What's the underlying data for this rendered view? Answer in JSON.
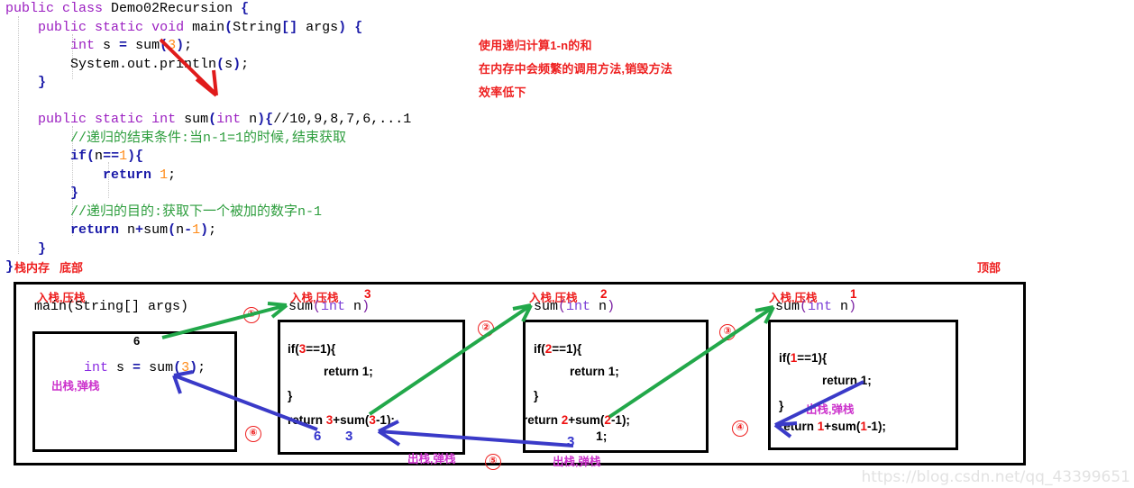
{
  "code": {
    "lines": [
      [
        {
          "t": "public",
          "c": "kw"
        },
        {
          "t": " ",
          "c": ""
        },
        {
          "t": "class",
          "c": "kw"
        },
        {
          "t": " Demo02Recursion ",
          "c": ""
        },
        {
          "t": "{",
          "c": "blu"
        }
      ],
      [
        {
          "t": "    ",
          "c": ""
        },
        {
          "t": "public",
          "c": "kw"
        },
        {
          "t": " ",
          "c": ""
        },
        {
          "t": "static",
          "c": "kw"
        },
        {
          "t": " ",
          "c": ""
        },
        {
          "t": "void",
          "c": "kw"
        },
        {
          "t": " main",
          "c": ""
        },
        {
          "t": "(",
          "c": "blu"
        },
        {
          "t": "String",
          "c": ""
        },
        {
          "t": "[]",
          "c": "blu"
        },
        {
          "t": " args",
          "c": ""
        },
        {
          "t": ")",
          "c": "blu"
        },
        {
          "t": " ",
          "c": ""
        },
        {
          "t": "{",
          "c": "blu"
        }
      ],
      [
        {
          "t": "        ",
          "c": ""
        },
        {
          "t": "int",
          "c": "kw"
        },
        {
          "t": " s ",
          "c": ""
        },
        {
          "t": "=",
          "c": "blu"
        },
        {
          "t": " sum",
          "c": ""
        },
        {
          "t": "(",
          "c": "blu"
        },
        {
          "t": "3",
          "c": "num"
        },
        {
          "t": ")",
          "c": "blu"
        },
        {
          "t": ";",
          "c": ""
        }
      ],
      [
        {
          "t": "        System.out.println",
          "c": ""
        },
        {
          "t": "(",
          "c": "blu"
        },
        {
          "t": "s",
          "c": ""
        },
        {
          "t": ")",
          "c": "blu"
        },
        {
          "t": ";",
          "c": ""
        }
      ],
      [
        {
          "t": "    ",
          "c": ""
        },
        {
          "t": "}",
          "c": "blu"
        }
      ],
      [
        {
          "t": "",
          "c": ""
        }
      ],
      [
        {
          "t": "    ",
          "c": ""
        },
        {
          "t": "public",
          "c": "kw"
        },
        {
          "t": " ",
          "c": ""
        },
        {
          "t": "static",
          "c": "kw"
        },
        {
          "t": " ",
          "c": ""
        },
        {
          "t": "int",
          "c": "kw"
        },
        {
          "t": " sum",
          "c": ""
        },
        {
          "t": "(",
          "c": "blu"
        },
        {
          "t": "int",
          "c": "kw"
        },
        {
          "t": " n",
          "c": ""
        },
        {
          "t": ")",
          "c": "blu"
        },
        {
          "t": "{",
          "c": "blu"
        },
        {
          "t": "//10,9,8,7,6,...1",
          "c": ""
        }
      ],
      [
        {
          "t": "        ",
          "c": ""
        },
        {
          "t": "//递归的结束条件:当n-1=1的时候,结束获取",
          "c": "cmt"
        }
      ],
      [
        {
          "t": "        ",
          "c": ""
        },
        {
          "t": "if",
          "c": "blu"
        },
        {
          "t": "(",
          "c": "blu"
        },
        {
          "t": "n",
          "c": ""
        },
        {
          "t": "==",
          "c": "blu"
        },
        {
          "t": "1",
          "c": "num"
        },
        {
          "t": ")",
          "c": "blu"
        },
        {
          "t": "{",
          "c": "blu"
        }
      ],
      [
        {
          "t": "            ",
          "c": ""
        },
        {
          "t": "return",
          "c": "blu"
        },
        {
          "t": " ",
          "c": ""
        },
        {
          "t": "1",
          "c": "num"
        },
        {
          "t": ";",
          "c": ""
        }
      ],
      [
        {
          "t": "        ",
          "c": ""
        },
        {
          "t": "}",
          "c": "blu"
        }
      ],
      [
        {
          "t": "        ",
          "c": ""
        },
        {
          "t": "//递归的目的:获取下一个被加的数字n-1",
          "c": "cmt"
        }
      ],
      [
        {
          "t": "        ",
          "c": ""
        },
        {
          "t": "return",
          "c": "blu"
        },
        {
          "t": " n",
          "c": ""
        },
        {
          "t": "+",
          "c": "blu"
        },
        {
          "t": "sum",
          "c": ""
        },
        {
          "t": "(",
          "c": "blu"
        },
        {
          "t": "n",
          "c": ""
        },
        {
          "t": "-",
          "c": "blu"
        },
        {
          "t": "1",
          "c": "num"
        },
        {
          "t": ")",
          "c": "blu"
        },
        {
          "t": ";",
          "c": ""
        }
      ],
      [
        {
          "t": "    ",
          "c": ""
        },
        {
          "t": "}",
          "c": "blu"
        }
      ],
      [
        {
          "t": "",
          "c": "blu"
        },
        {
          "t": "}",
          "c": "blu"
        }
      ]
    ]
  },
  "notes": {
    "line1": "使用递归计算1-n的和",
    "line2": "在内存中会频繁的调用方法,销毁方法",
    "line3": "效率低下"
  },
  "stack": {
    "memory_label": "栈内存",
    "bottom_label": "底部",
    "top_label": "顶部",
    "push_label": "入栈,压栈",
    "pop_label": "出栈,弹栈",
    "frames": [
      {
        "signature_main": "main(String[] args)",
        "push": "入栈,压栈",
        "body_line": "int s = sum(3);",
        "result_above": "6",
        "pop": "出栈,弹栈"
      },
      {
        "push": "入栈,压栈",
        "arg": "3",
        "signature": "sum(int n)",
        "if_line": "if(3==1){",
        "return_one": "return 1;",
        "close_brace": "}",
        "return_line": "return 3+sum(3-1);",
        "val_left": "6",
        "val_right": "3",
        "pop": "出栈,弹栈"
      },
      {
        "push": "入栈,压栈",
        "arg": "2",
        "signature": "sum(int n)",
        "if_line": "if(2==1){",
        "return_one": "return 1;",
        "close_brace": "}",
        "return_line": "return 2+sum(2-1);",
        "val_left": "3",
        "val_right": "1;",
        "pop": "出栈,弹栈"
      },
      {
        "push": "入栈,压栈",
        "arg": "1",
        "signature": "sum(int n)",
        "if_line": "if(1==1){",
        "return_one": "return 1;",
        "close_brace": "}",
        "return_line": "return 1+sum(1-1);",
        "pop": "出栈,弹栈"
      }
    ],
    "steps": [
      "①",
      "②",
      "③",
      "④",
      "⑤",
      "⑥"
    ]
  },
  "colors": {
    "red": "#ee2020",
    "green_arrow": "#22a84a",
    "blue_arrow": "#3a3ac8",
    "red_arrow": "#e01b1b",
    "purple_pop": "#cc33cc",
    "blue_value": "#3333cc",
    "keyword": "#9b1fc1",
    "comment": "#2e9e3e",
    "number": "#ff8c1a",
    "brace_blue": "#1a1aa8"
  },
  "watermark": "https://blog.csdn.net/qq_43399651"
}
